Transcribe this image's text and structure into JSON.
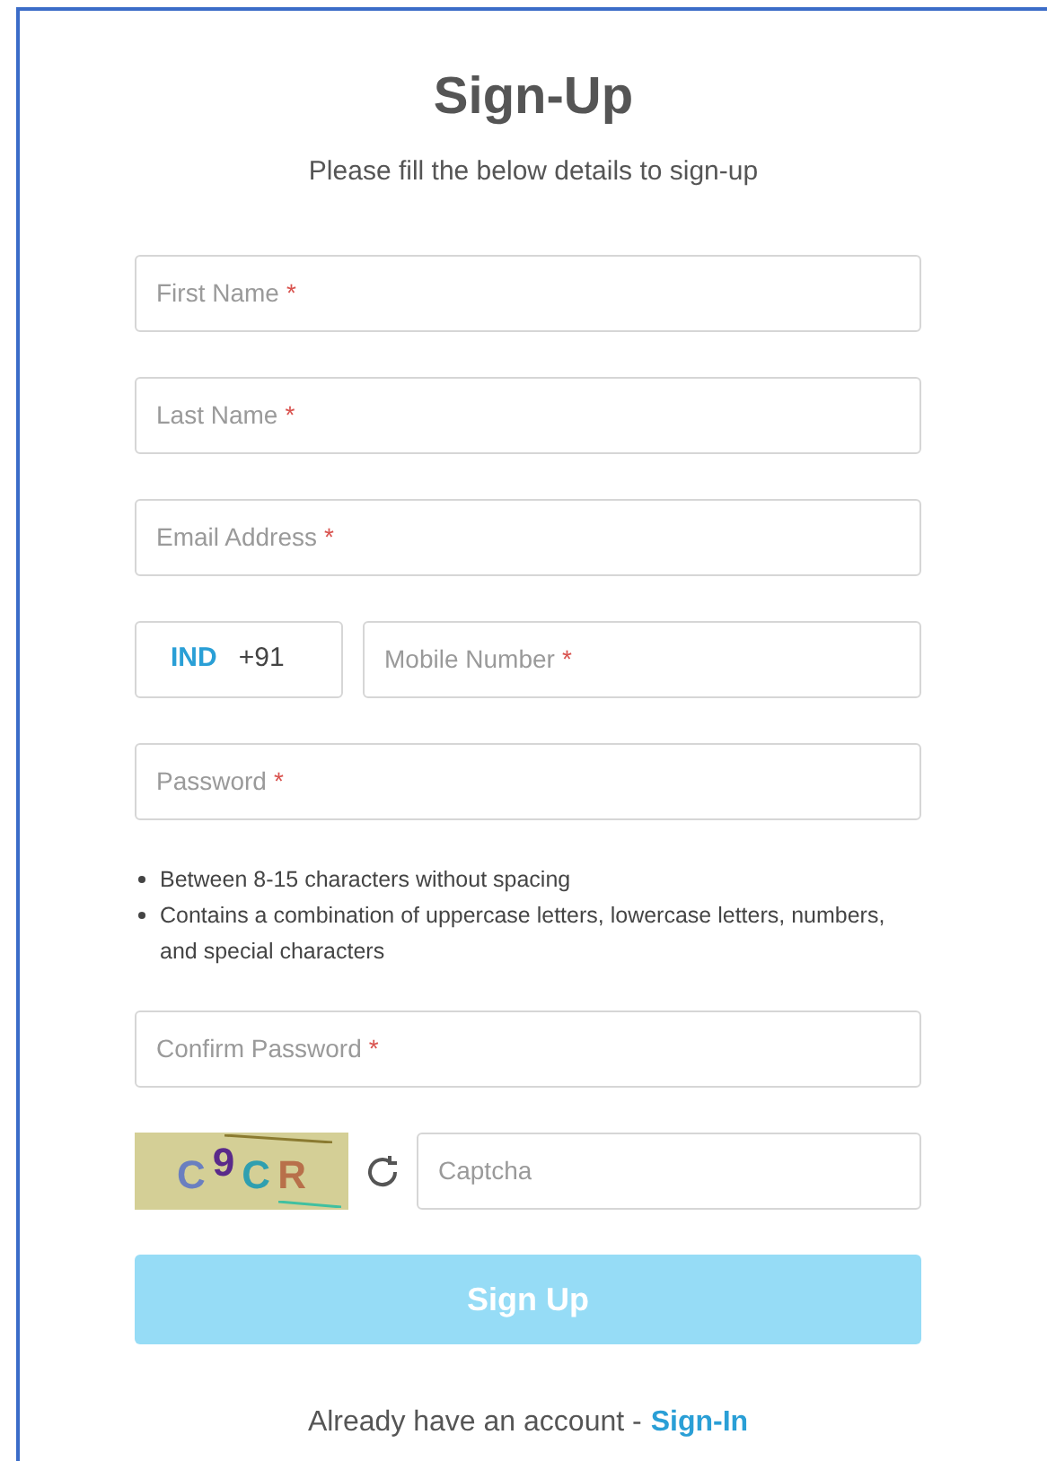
{
  "title": "Sign-Up",
  "subtitle": "Please fill the below details to sign-up",
  "fields": [
    {
      "kind": "text",
      "placeholder": "First Name",
      "mark": "*"
    },
    {
      "kind": "text",
      "placeholder": "Last Name",
      "mark": "*"
    },
    {
      "kind": "text",
      "placeholder": "Email Address",
      "mark": "*"
    },
    {
      "kind": "phone",
      "country": "IND",
      "code": "+91",
      "placeholder": "Mobile Number",
      "mark": "*"
    },
    {
      "kind": "text",
      "placeholder": "Password",
      "mark": "*"
    },
    {
      "kind": "hints",
      "items": [
        "Between 8-15 characters without spacing",
        "Contains a combination of uppercase letters, lowercase letters, numbers, and special characters"
      ]
    },
    {
      "kind": "text",
      "placeholder": "Confirm Password",
      "mark": "*"
    },
    {
      "kind": "captcha",
      "chars": [
        {
          "char": "C",
          "color": "#6a7fc0"
        },
        {
          "char": "9",
          "color": "#5a2a8a"
        },
        {
          "char": "C",
          "color": "#2f9fb0"
        },
        {
          "char": "R",
          "color": "#b8704a"
        }
      ],
      "placeholder": "Captcha"
    }
  ],
  "submit": {
    "label": "Sign Up",
    "disabled": true
  },
  "footer": {
    "text": "Already have an account -",
    "link": "Sign-In"
  }
}
